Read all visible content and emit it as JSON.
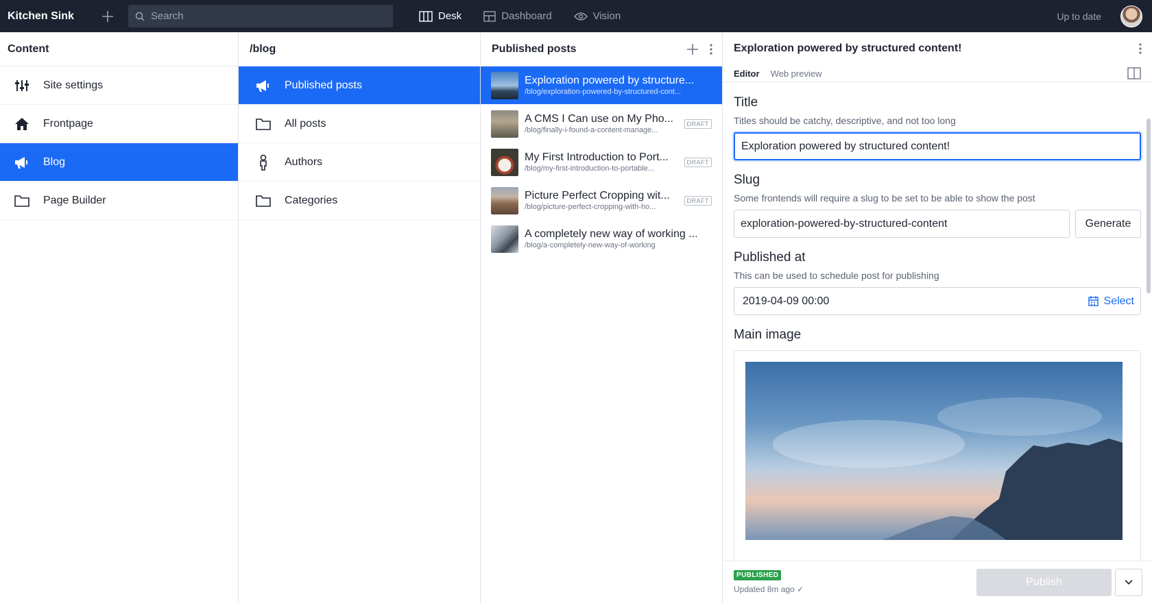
{
  "topbar": {
    "brand": "Kitchen Sink",
    "search_placeholder": "Search",
    "nav": [
      {
        "label": "Desk",
        "icon": "desk-icon",
        "active": true
      },
      {
        "label": "Dashboard",
        "icon": "dashboard-icon",
        "active": false
      },
      {
        "label": "Vision",
        "icon": "eye-icon",
        "active": false
      }
    ],
    "status": "Up to date"
  },
  "pane1": {
    "title": "Content",
    "items": [
      {
        "label": "Site settings",
        "icon": "sliders-icon"
      },
      {
        "label": "Frontpage",
        "icon": "home-icon"
      },
      {
        "label": "Blog",
        "icon": "megaphone-icon",
        "selected": true
      },
      {
        "label": "Page Builder",
        "icon": "folder-icon"
      }
    ]
  },
  "pane2": {
    "title": "/blog",
    "items": [
      {
        "label": "Published posts",
        "icon": "megaphone-icon",
        "selected": true
      },
      {
        "label": "All posts",
        "icon": "folder-icon"
      },
      {
        "label": "Authors",
        "icon": "person-icon"
      },
      {
        "label": "Categories",
        "icon": "folder-icon"
      }
    ]
  },
  "pane3": {
    "title": "Published posts",
    "items": [
      {
        "title": "Exploration powered by structure...",
        "slug": "/blog/exploration-powered-by-structured-cont...",
        "draft": "",
        "selected": true
      },
      {
        "title": "A CMS I Can use on My Pho...",
        "slug": "/blog/finally-i-found-a-content-manage...",
        "draft": "DRAFT"
      },
      {
        "title": "My First Introduction to Port...",
        "slug": "/blog/my-first-introduction-to-portable...",
        "draft": "DRAFT"
      },
      {
        "title": "Picture Perfect Cropping wit...",
        "slug": "/blog/picture-perfect-cropping-with-ho...",
        "draft": "DRAFT"
      },
      {
        "title": "A completely new way of working ...",
        "slug": "/blog/a-completely-new-way-of-working",
        "draft": ""
      }
    ]
  },
  "editor": {
    "title": "Exploration powered by structured content!",
    "tabs": [
      "Editor",
      "Web preview"
    ],
    "fields": {
      "title_label": "Title",
      "title_desc": "Titles should be catchy, descriptive, and not too long",
      "title_value": "Exploration powered by structured content!",
      "slug_label": "Slug",
      "slug_desc": "Some frontends will require a slug to be set to be able to show the post",
      "slug_value": "exploration-powered-by-structured-content",
      "generate": "Generate",
      "published_label": "Published at",
      "published_desc": "This can be used to schedule post for publishing",
      "published_value": "2019-04-09 00:00",
      "select": "Select",
      "image_label": "Main image"
    },
    "footer": {
      "badge": "PUBLISHED",
      "updated": "Updated 8m ago ✓",
      "publish": "Publish"
    }
  },
  "colors": {
    "topbar": "#1c2230",
    "accent": "#1b6af5",
    "published": "#2aa24b"
  }
}
